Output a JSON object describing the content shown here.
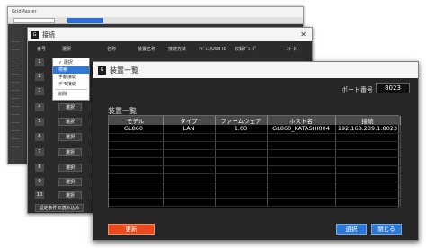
{
  "background_window": {
    "title": "GridMaster"
  },
  "connection_window": {
    "title": "接続",
    "columns": {
      "no": "番号",
      "select": "選択",
      "name": "名称",
      "device_name": "装置名称",
      "method": "接続方法",
      "address": "ｱﾄﾞﾚｽ/USB ID",
      "group": "収録ｸﾞﾙｰﾌﾟ",
      "status": "ｽﾃｰﾀｽ"
    },
    "rows": [
      {
        "num": "1",
        "btn": "選択"
      },
      {
        "num": "2",
        "btn": "選択"
      },
      {
        "num": "3",
        "btn": "選択"
      },
      {
        "num": "4",
        "btn": "選択"
      },
      {
        "num": "5",
        "btn": "選択"
      },
      {
        "num": "6",
        "btn": "選択"
      },
      {
        "num": "7",
        "btn": "選択"
      },
      {
        "num": "8",
        "btn": "選択"
      },
      {
        "num": "9",
        "btn": "選択"
      },
      {
        "num": "10",
        "btn": "選択"
      }
    ],
    "footer_button": "設定条件の読み込み"
  },
  "dropdown": {
    "items": [
      "選択",
      "検索",
      "手動接続",
      "デモ接続",
      "削除"
    ],
    "checked": "選択",
    "highlighted": "検索"
  },
  "device_list_window": {
    "title": "装置一覧",
    "port_label": "ポート番号",
    "port_value": "8023",
    "list_label": "装置一覧",
    "table_headers": [
      "モデル",
      "タイプ",
      "ファームウェア",
      "ホスト名",
      "接続"
    ],
    "rows": [
      {
        "model": "GL860",
        "type": "LAN",
        "firmware": "1.03",
        "host": "GL860_KATASHI004",
        "connection": "192.168.239.1:8023"
      }
    ],
    "empty_rows": 10,
    "buttons": {
      "update": "更新",
      "select": "選択",
      "close": "閉じる"
    }
  },
  "colors": {
    "update_button": "#e8491d",
    "primary_button": "#2d78d6",
    "table_bg": "#000000",
    "window_bg": "#262626"
  },
  "icons": {
    "app_icon": "app-logo-icon",
    "close_icon": "close-icon",
    "check_icon": "check-icon"
  }
}
